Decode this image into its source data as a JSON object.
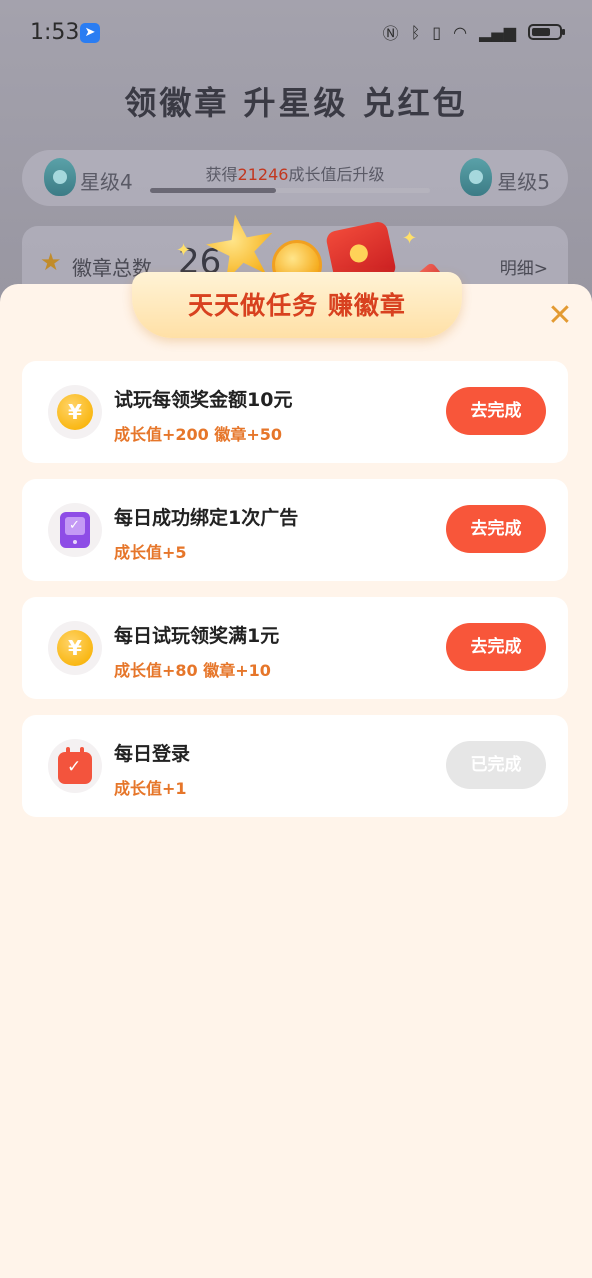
{
  "status_bar": {
    "time": "1:53",
    "icons": [
      "nfc-icon",
      "bluetooth-icon",
      "vibrate-icon",
      "wifi-icon",
      "signal-icon",
      "battery-icon"
    ]
  },
  "background": {
    "headline": "领徽章  升星级 兑红包",
    "level": {
      "current": "星级4",
      "next": "星级5",
      "progress_prefix": "获得",
      "progress_value": "21246",
      "progress_suffix": "成长值后升级",
      "progress_fraction": 0.45
    },
    "badges": {
      "label": "徽章总数",
      "value": "26",
      "detail_link": "明细>"
    }
  },
  "sheet": {
    "title": "天天做任务 赚徽章",
    "close_icon": "close-icon",
    "tasks": [
      {
        "icon": "yuan-coin-icon",
        "title": "试玩每领奖金额10元",
        "reward": "成长值+200 徽章+50",
        "button": "去完成",
        "completed": false
      },
      {
        "icon": "tablet-check-icon",
        "title": "每日成功绑定1次广告",
        "reward": "成长值+5",
        "button": "去完成",
        "completed": false
      },
      {
        "icon": "yuan-coin-icon",
        "title": "每日试玩领奖满1元",
        "reward": "成长值+80 徽章+10",
        "button": "去完成",
        "completed": false
      },
      {
        "icon": "calendar-check-icon",
        "title": "每日登录",
        "reward": "成长值+1",
        "button": "已完成",
        "completed": true
      }
    ]
  },
  "colors": {
    "accent": "#f8563a",
    "reward": "#e6762a",
    "sheet_bg": "#fff4ea",
    "banner_title": "#d8411f"
  }
}
